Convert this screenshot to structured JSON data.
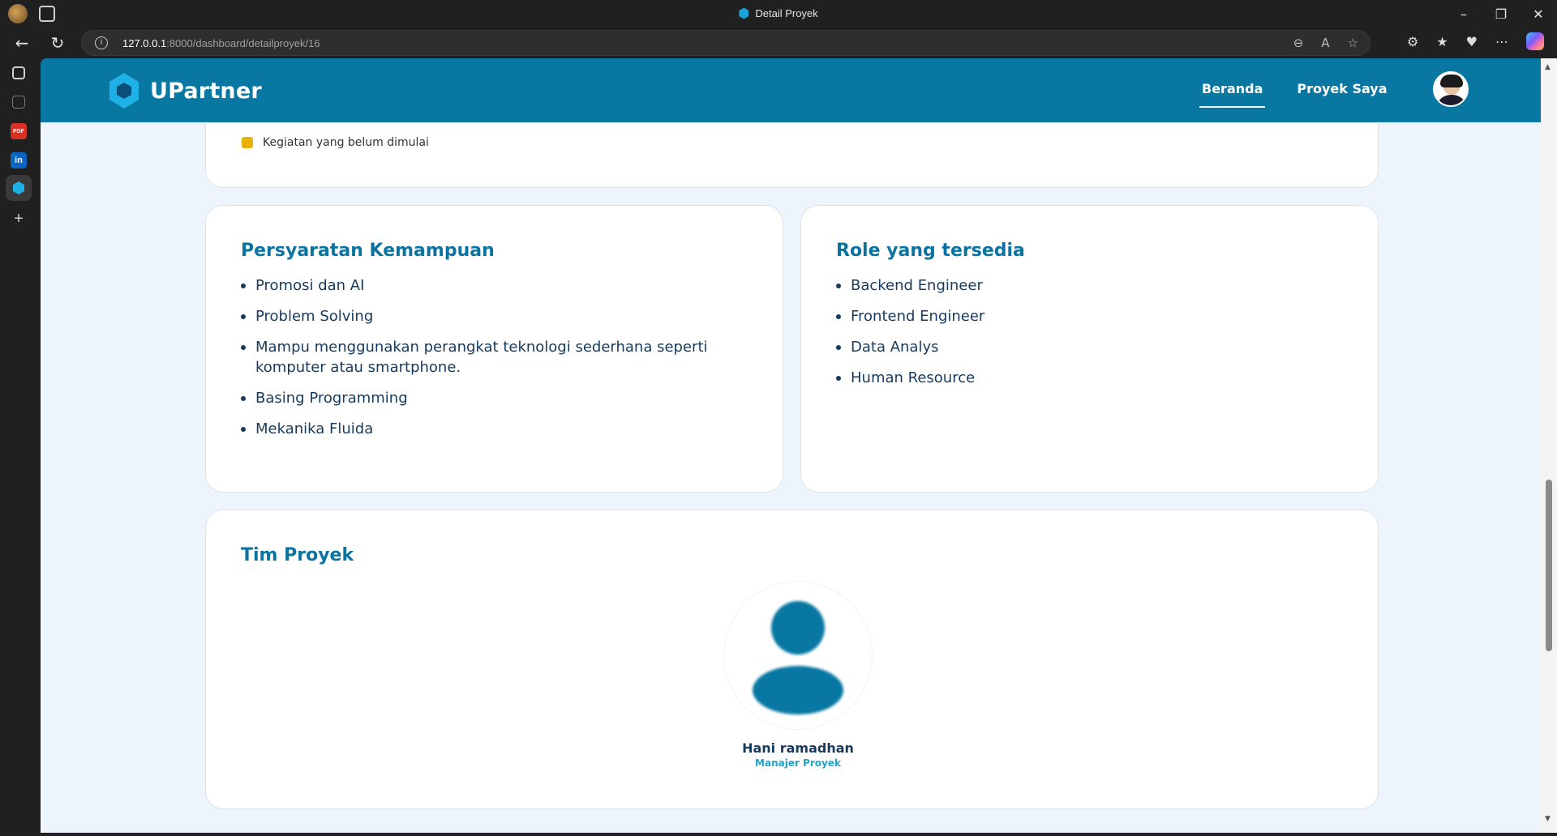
{
  "browser": {
    "tab_title": "Detail Proyek",
    "url_host": "127.0.0.1",
    "url_rest": ":8000/dashboard/detailproyek/16"
  },
  "app": {
    "brand": "UPartner",
    "nav": [
      {
        "label": "Beranda",
        "active": true
      },
      {
        "label": "Proyek Saya",
        "active": false
      }
    ]
  },
  "legend": {
    "label": "Kegiatan yang belum dimulai",
    "color": "#e8b10c"
  },
  "skills": {
    "title": "Persyaratan Kemampuan",
    "items": [
      "Promosi dan AI",
      "Problem Solving",
      "Mampu menggunakan perangkat teknologi sederhana seperti komputer atau smartphone.",
      "Basing Programming",
      "Mekanika Fluida"
    ]
  },
  "roles": {
    "title": "Role yang tersedia",
    "items": [
      "Backend Engineer",
      "Frontend Engineer",
      "Data Analys",
      "Human Resource"
    ]
  },
  "team": {
    "title": "Tim Proyek",
    "members": [
      {
        "name": "Hani ramadhan",
        "role": "Manajer Proyek"
      }
    ]
  },
  "colors": {
    "header_bg": "#0878a3",
    "title_color": "#0a73a0",
    "text_color": "#163a5e",
    "role_color": "#20a4c8"
  }
}
